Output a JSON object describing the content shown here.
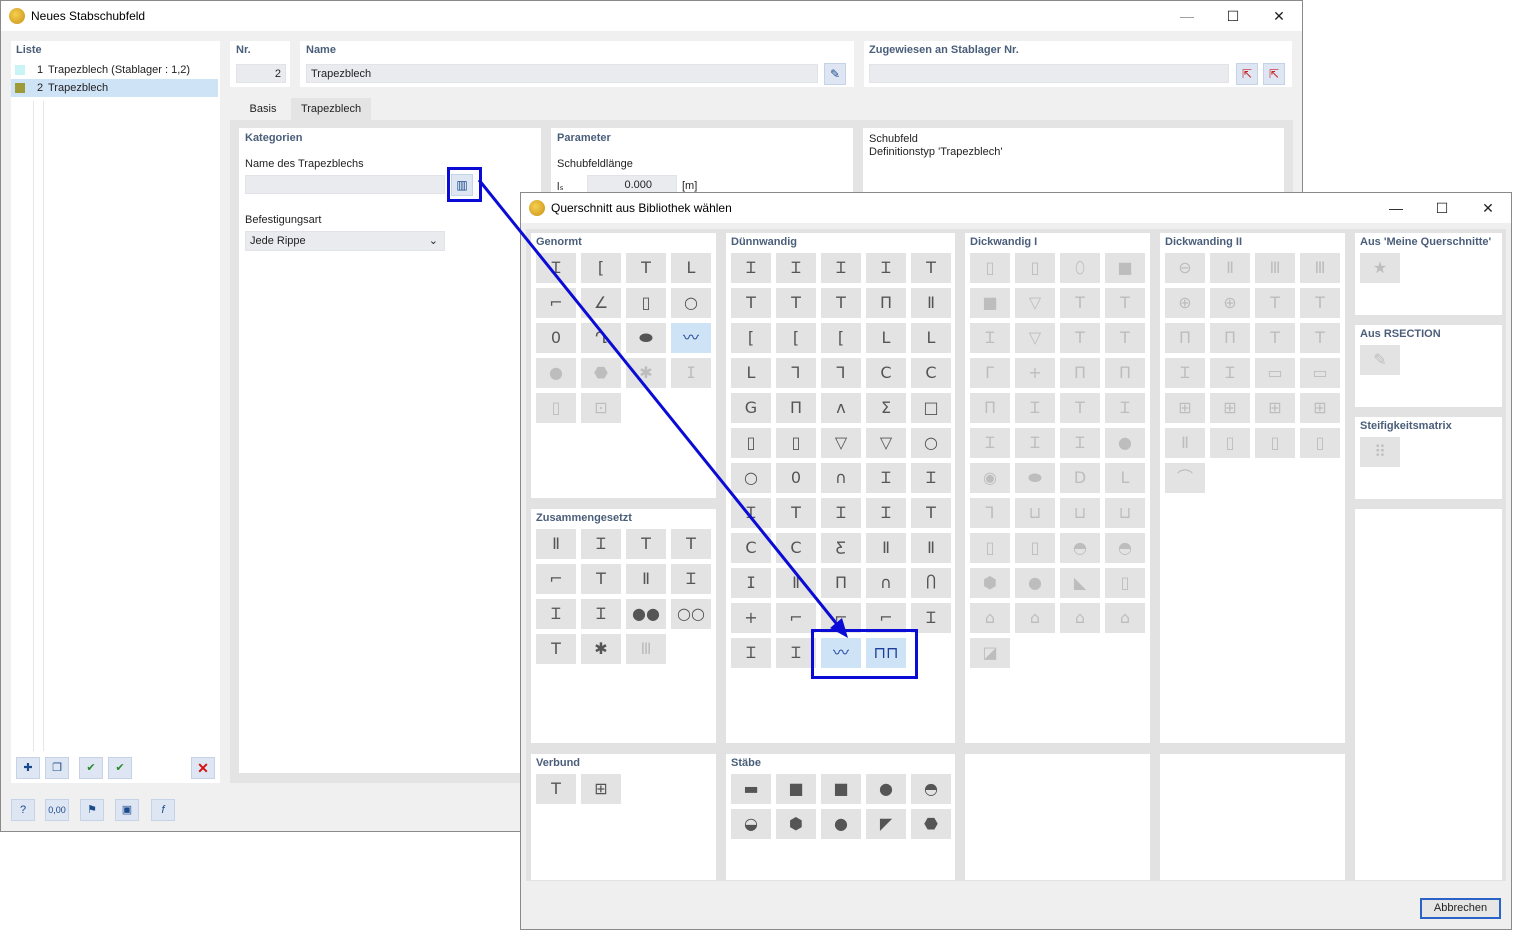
{
  "main": {
    "title": "Neues Stabschubfeld",
    "list": {
      "header": "Liste",
      "items": [
        {
          "num": "1",
          "label": "Trapezblech (Stablager : 1,2)",
          "color": "#c8f4f6"
        },
        {
          "num": "2",
          "label": "Trapezblech",
          "color": "#9e9a38"
        }
      ]
    },
    "nr": {
      "label": "Nr.",
      "value": "2"
    },
    "name": {
      "label": "Name",
      "value": "Trapezblech"
    },
    "assigned": {
      "label": "Zugewiesen an Stablager Nr.",
      "value": ""
    },
    "tabs": [
      "Basis",
      "Trapezblech"
    ],
    "kategorien": {
      "header": "Kategorien",
      "name_label": "Name des Trapezblechs",
      "name_value": "",
      "befestigung_label": "Befestigungsart",
      "befestigung_value": "Jede Rippe"
    },
    "parameter": {
      "header": "Parameter",
      "length_label": "Schubfeldlänge",
      "symbol": "lₛ",
      "value": "0.000",
      "unit": "[m]"
    },
    "info": {
      "line1": "Schubfeld",
      "line2": "Definitionstyp 'Trapezblech'"
    }
  },
  "dialog": {
    "title": "Querschnitt aus Bibliothek wählen",
    "groups": {
      "genormt": "Genormt",
      "duennwandig": "Dünnwandig",
      "dickwandig1": "Dickwandig I",
      "dickwandig2": "Dickwanding II",
      "meine": "Aus 'Meine Querschnitte'",
      "rsection": "Aus RSECTION",
      "steifigkeit": "Steifigkeitsmatrix",
      "zusammengesetzt": "Zusammengesetzt",
      "verbund": "Verbund",
      "staebe": "Stäbe"
    },
    "cancel_label": "Abbrechen"
  },
  "icons": {
    "genormt": [
      "Ɪ",
      "[",
      "T",
      "L",
      "⌐",
      "∠",
      "▯",
      "○",
      "0",
      "Ղ",
      "⬬",
      "〰",
      "●",
      "⬣",
      "✱",
      "ⵊ",
      "▯",
      "⊡"
    ],
    "duennwandig": [
      "Ɪ",
      "Ɪ",
      "Ɪ",
      "Ɪ",
      "T",
      "T",
      "T",
      "T",
      "Π",
      "Ⅱ",
      "[",
      "[",
      "[",
      "L",
      "L",
      "L",
      "Ꞁ",
      "Ꞁ",
      "C",
      "C",
      "G",
      "Π",
      "ʌ",
      "Σ",
      "□",
      "▯",
      "▯",
      "▽",
      "▽",
      "○",
      "○",
      "0",
      "∩",
      "Ɪ",
      "Ɪ",
      "Ɪ",
      "T",
      "Ɪ",
      "Ɪ",
      "T",
      "C",
      "C",
      "Ƹ",
      "Ⅱ",
      "Ⅱ",
      "ⵊ",
      "Ⅱ",
      "Π",
      "∩",
      "Ⴖ",
      "+",
      "⌐",
      "⌐",
      "⌐",
      "Ɪ",
      "Ɪ",
      "Ɪ",
      "〰",
      "⊓⊓"
    ],
    "dickwandig1": [
      "▯",
      "▯",
      "⬯",
      "■",
      "■",
      "▽",
      "T",
      "T",
      "Ɪ",
      "▽",
      "T",
      "T",
      "Г",
      "+",
      "Π",
      "Π",
      "Π",
      "Ɪ",
      "T",
      "Ɪ",
      "Ɪ",
      "Ɪ",
      "Ɪ",
      "●",
      "◉",
      "⬬",
      "D",
      "L",
      "Ꞁ",
      "⊔",
      "⊔",
      "⊔",
      "▯",
      "▯",
      "◓",
      "◓",
      "⬢",
      "●",
      "◣",
      "▯",
      "⌂",
      "⌂",
      "⌂",
      "⌂",
      "◪"
    ],
    "dickwandig2": [
      "⊖",
      "Ⅱ",
      "Ⅲ",
      "Ⅲ",
      "⊕",
      "⊕",
      "T",
      "T",
      "Π",
      "Π",
      "T",
      "T",
      "Ɪ",
      "Ɪ",
      "▭",
      "▭",
      "⊞",
      "⊞",
      "⊞",
      "⊞",
      "Ⅱ",
      "▯",
      "▯",
      "▯",
      "⌒"
    ],
    "meine": [
      "★"
    ],
    "rsection": [
      "✎"
    ],
    "steifigkeit": [
      "⠿"
    ],
    "zusammengesetzt": [
      "Ⅱ",
      "Ɪ",
      "T",
      "T",
      "⌐",
      "T",
      "Ⅱ",
      "Ɪ",
      "Ɪ",
      "Ɪ",
      "●●",
      "○○",
      "T",
      "✱",
      "Ⅲ"
    ],
    "verbund": [
      "T",
      "⊞"
    ],
    "staebe": [
      "▬",
      "■",
      "■",
      "●",
      "◓",
      "◒",
      "⬢",
      "●",
      "◤",
      "⬣"
    ]
  },
  "toolbar_list": [
    "new-icon",
    "copy-icon",
    "check-icon",
    "check-all-icon",
    "delete-icon"
  ],
  "toolbar_bottom": [
    "help-icon",
    "units-icon",
    "model-icon",
    "view-icon",
    "function-icon"
  ]
}
